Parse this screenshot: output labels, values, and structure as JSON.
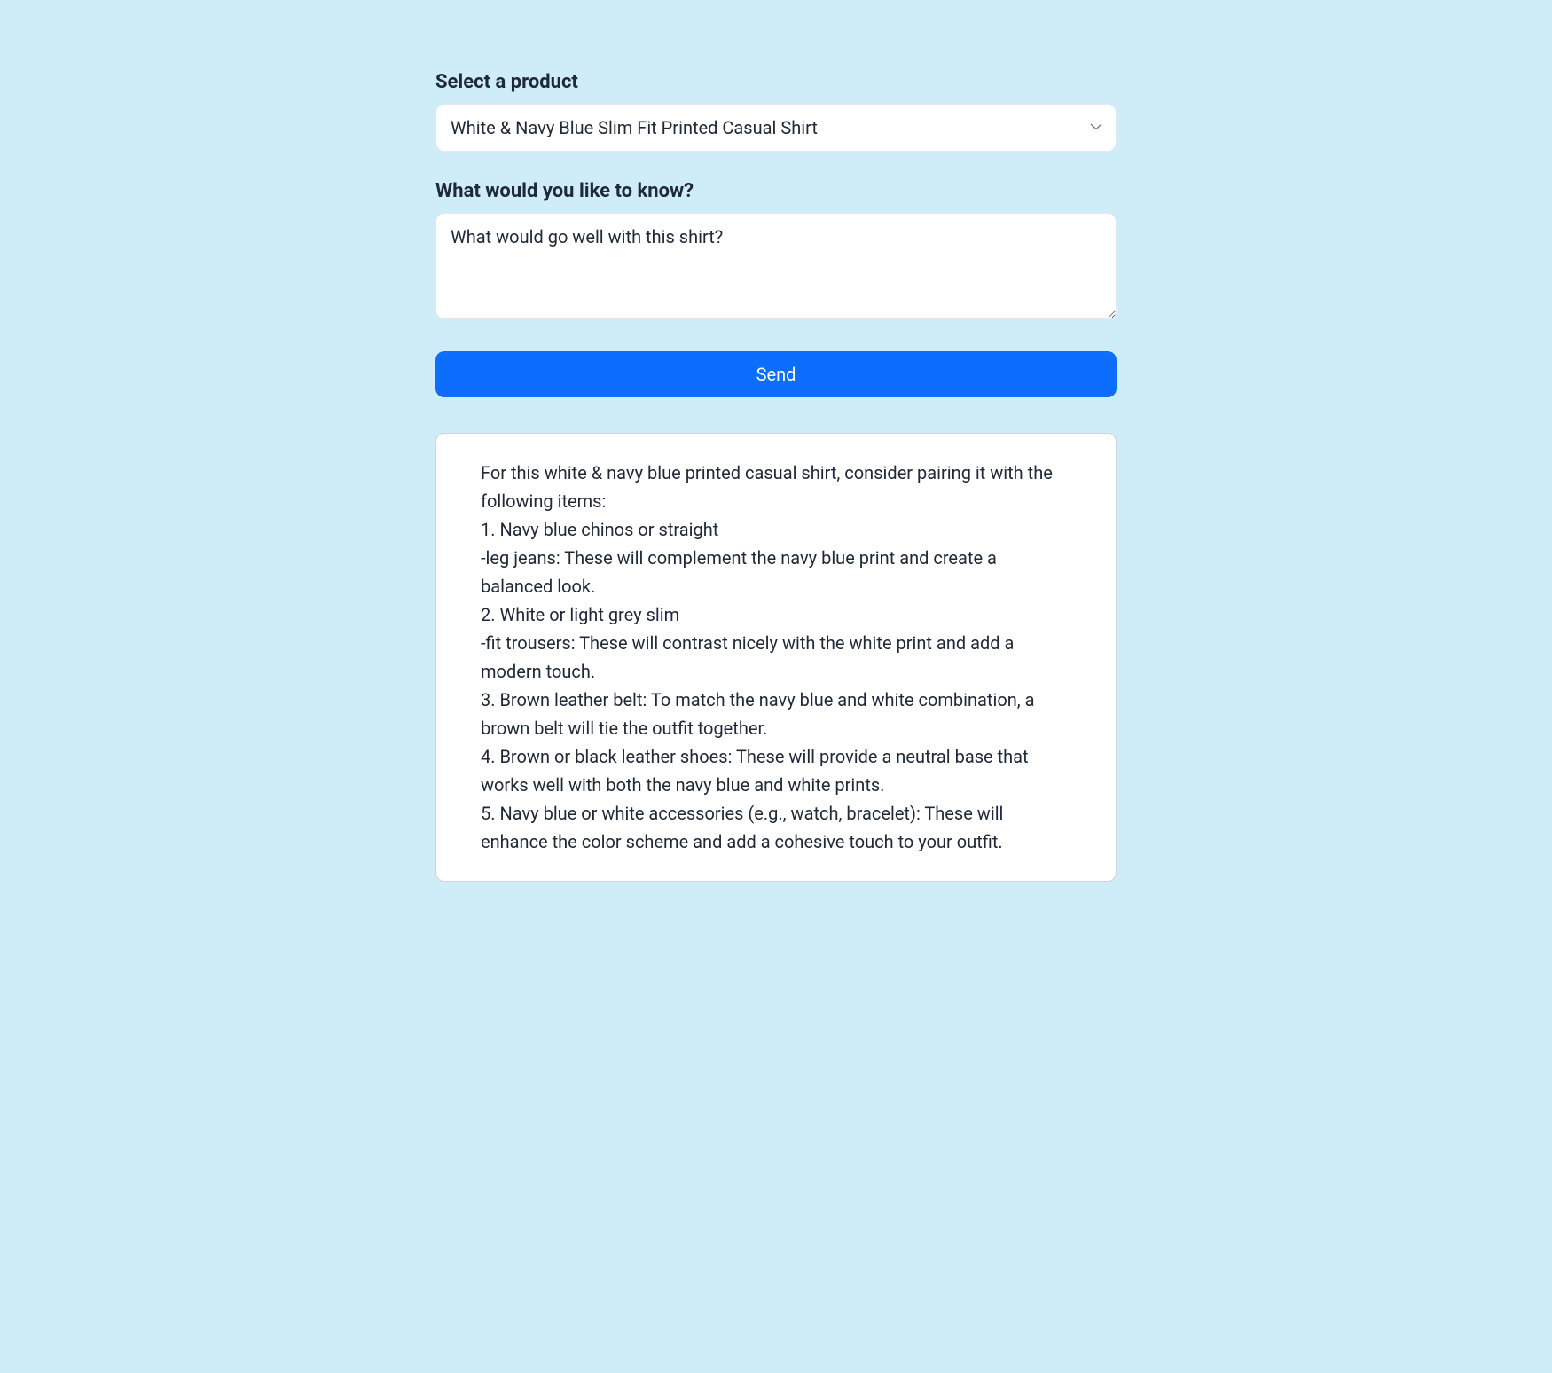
{
  "form": {
    "product_label": "Select a product",
    "product_value": "White & Navy Blue Slim Fit Printed Casual Shirt",
    "question_label": "What would you like to know?",
    "question_value": "What would go well with this shirt?",
    "send_label": "Send"
  },
  "response": {
    "text": "For this white & navy blue printed casual shirt, consider pairing it with the following items:\n1. Navy blue chinos or straight\n-leg jeans: These will complement the navy blue print and create a balanced look.\n2. White or light grey slim\n-fit trousers: These will contrast nicely with the white print and add a modern touch.\n3. Brown leather belt: To match the navy blue and white combination, a brown belt will tie the outfit together.\n4. Brown or black leather shoes: These will provide a neutral base that works well with both the navy blue and white prints.\n5. Navy blue or white accessories (e.g., watch, bracelet): These will enhance the color scheme and add a cohesive touch to your outfit."
  }
}
